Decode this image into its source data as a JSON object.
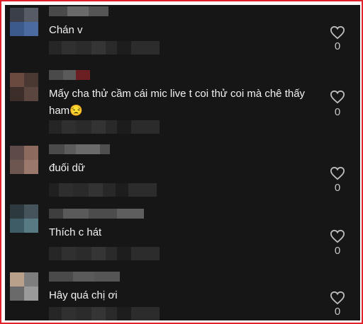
{
  "comments": [
    {
      "text": "Chán v",
      "likes": "0"
    },
    {
      "text": "Mấy cha thử cầm cái mic live t coi thử coi mà chê thấy ham😒",
      "likes": "0"
    },
    {
      "text": "đuối dữ",
      "likes": "0"
    },
    {
      "text": "Thích c hát",
      "likes": "0"
    },
    {
      "text": "Hây quá chị ơi",
      "likes": "0"
    }
  ],
  "icons": {
    "like": "heart-outline-icon"
  },
  "colors": {
    "frame_border": "#e2222a",
    "panel_bg": "#161616",
    "text": "#f2f2f2",
    "count": "#c9c9c9"
  }
}
